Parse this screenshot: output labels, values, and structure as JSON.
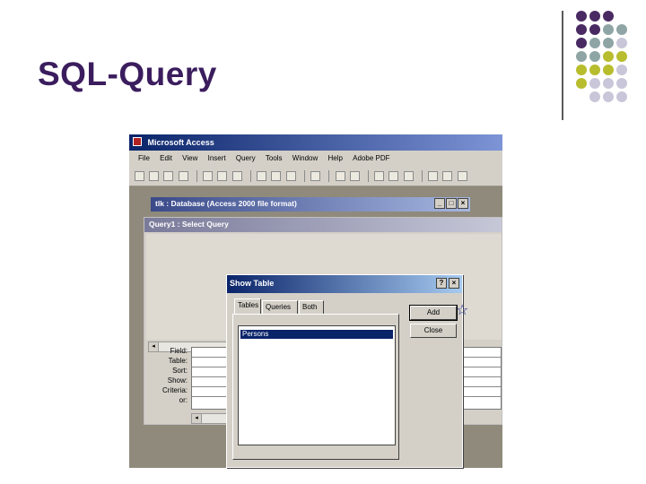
{
  "slide": {
    "title": "SQL-Query"
  },
  "colors": {
    "title": "#3b1d5e",
    "dot_purple": "#4a2a63",
    "dot_teal": "#8fa5a5",
    "dot_olive": "#b8bd2e",
    "dot_lilac": "#c9c6d9"
  },
  "app": {
    "title": "Microsoft Access",
    "menu": [
      "File",
      "Edit",
      "View",
      "Insert",
      "Query",
      "Tools",
      "Window",
      "Help",
      "Adobe PDF"
    ]
  },
  "database_window": {
    "title": "tlk : Database (Access 2000 file format)"
  },
  "query_window": {
    "title": "Query1 : Select Query",
    "grid_labels": [
      "Field:",
      "Table:",
      "Sort:",
      "Show:",
      "Criteria:",
      "or:"
    ]
  },
  "show_table": {
    "title": "Show Table",
    "help_symbol": "?",
    "close_symbol": "×",
    "tabs": [
      "Tables",
      "Queries",
      "Both"
    ],
    "items": [
      "Persons"
    ],
    "add_label": "Add",
    "close_label": "Close"
  },
  "cursor_symbol": "☆",
  "window_controls": {
    "minimize": "_",
    "maximize": "□",
    "close": "×"
  }
}
